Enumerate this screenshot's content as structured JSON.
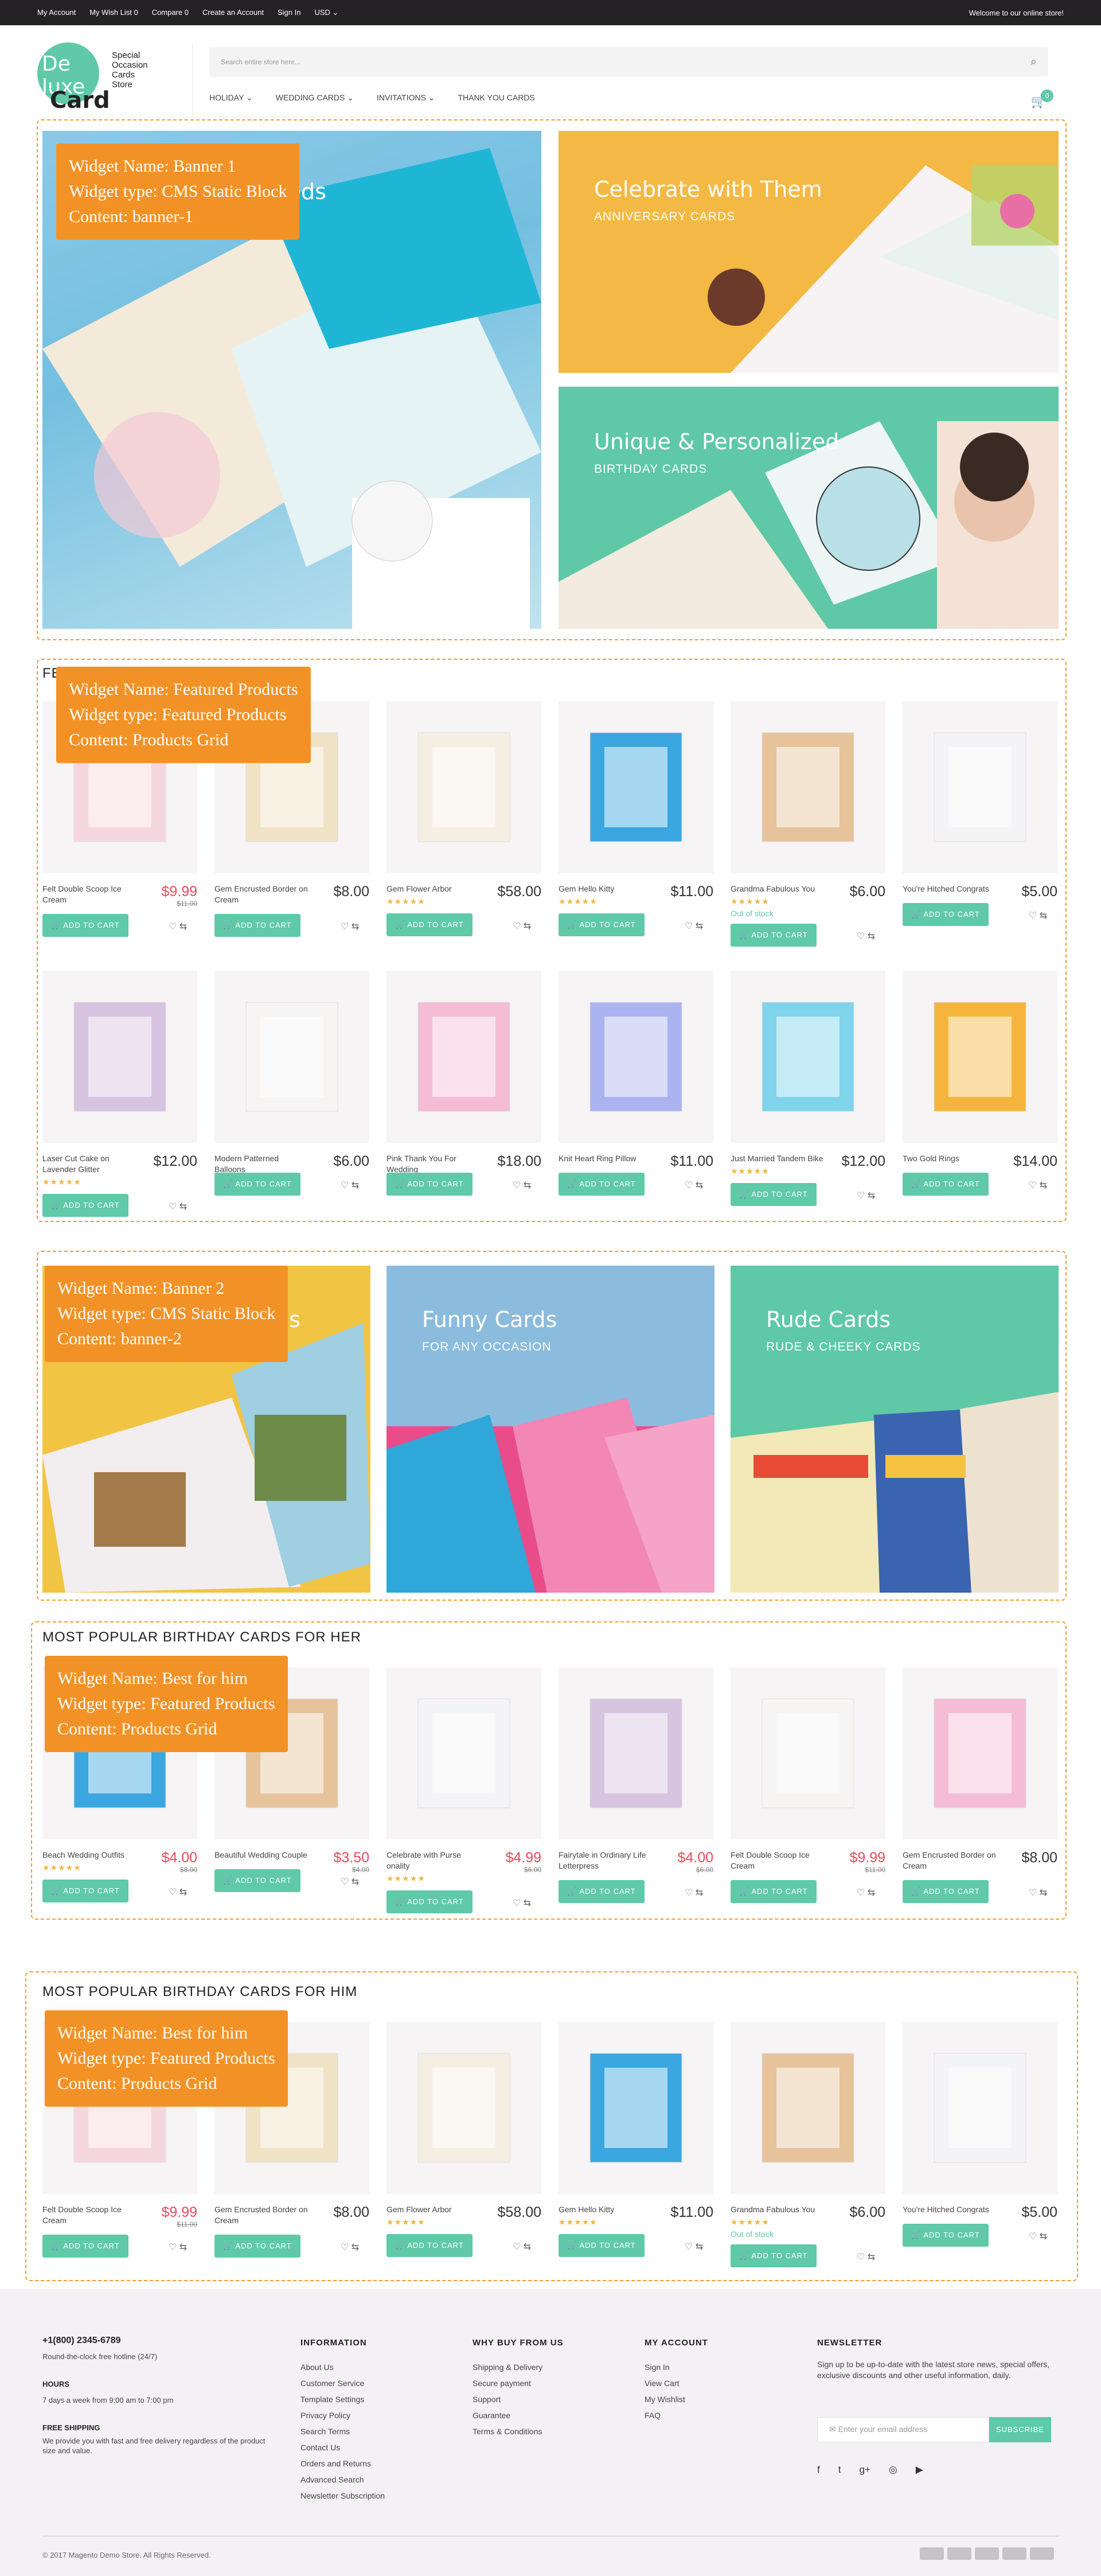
{
  "topbar": {
    "links": [
      "My Account",
      "My Wish List 0",
      "Compare 0",
      "Create an Account",
      "Sign In",
      "USD ⌄"
    ],
    "welcome": "Welcome to our online store!"
  },
  "header": {
    "logo_top": "De luxe",
    "logo_bottom": "Card",
    "tagline": [
      "Special",
      "Occasion",
      "Cards",
      "Store"
    ],
    "search_placeholder": "Search entire store here...",
    "nav": [
      "HOLIDAY ⌄",
      "WEDDING CARDS ⌄",
      "INVITATIONS ⌄",
      "THANK YOU CARDS"
    ],
    "cart_count": "0"
  },
  "widgets": {
    "banner1": [
      "Widget Name: Banner 1",
      "Widget type: CMS Static Block",
      "Content: banner-1"
    ],
    "featured": [
      "Widget Name:  Featured Products",
      "Widget type: Featured Products",
      "Content:  Products Grid"
    ],
    "banner2": [
      "Widget Name: Banner 2",
      "Widget type: CMS Static Block",
      "Content: banner-2"
    ],
    "best_her": [
      "Widget Name: Best for him",
      "Widget type: Featured Products",
      "Content: Products Grid"
    ],
    "best_him": [
      "Widget Name:  Best for him",
      "Widget type: Featured Products",
      "Content: Products Grid"
    ]
  },
  "banner1": {
    "main_title": "ewly-weds",
    "right_top_title": "Celebrate with Them",
    "right_top_sub": "ANNIVERSARY CARDS",
    "right_bottom_title": "Unique & Personalized",
    "right_bottom_sub": "BIRTHDAY CARDS"
  },
  "banner2": {
    "left_title": "ds",
    "mid_title": "Funny Cards",
    "mid_sub": "FOR ANY OCCASION",
    "right_title": "Rude Cards",
    "right_sub": "RUDE & CHEEKY CARDS"
  },
  "sections": {
    "featured_title": "FE",
    "her_title": "MOST POPULAR BIRTHDAY CARDS FOR HER",
    "him_title": "MOST POPULAR BIRTHDAY CARDS FOR HIM"
  },
  "add_to_cart": "ADD TO CART",
  "out_of_stock": "Out of stock",
  "featured_products": [
    {
      "name": "Felt Double Scoop Ice Cream",
      "price": "$9.99",
      "old": "$11.00",
      "sale": true
    },
    {
      "name": "Gem Encrusted Border on Cream",
      "price": "$8.00"
    },
    {
      "name": "Gem Flower Arbor",
      "price": "$58.00",
      "stars": "★★★★★"
    },
    {
      "name": "Gem Hello Kitty",
      "price": "$11.00",
      "stars": "★★★★★"
    },
    {
      "name": "Grandma Fabulous You",
      "price": "$6.00",
      "stars": "★★★★★",
      "oos": true
    },
    {
      "name": "You're Hitched Congrats",
      "price": "$5.00"
    },
    {
      "name": "Laser Cut Cake on Lavender Glitter",
      "price": "$12.00",
      "stars": "★★★★★"
    },
    {
      "name": "Modern Patterned Balloons",
      "price": "$6.00"
    },
    {
      "name": "Pink Thank You For Wedding",
      "price": "$18.00"
    },
    {
      "name": "Knit Heart Ring Pillow",
      "price": "$11.00"
    },
    {
      "name": "Just Married Tandem Bike",
      "price": "$12.00",
      "stars": "★★★★★"
    },
    {
      "name": "Two Gold Rings",
      "price": "$14.00"
    }
  ],
  "her_products": [
    {
      "name": "Beach Wedding Outfits",
      "price": "$4.00",
      "old": "$8.00",
      "sale": true,
      "stars": "★★★★★"
    },
    {
      "name": "Beautiful Wedding Couple",
      "price": "$3.50",
      "old": "$4.00",
      "sale": true
    },
    {
      "name": "Celebrate with Purse onality",
      "price": "$4.99",
      "old": "$6.00",
      "sale": true,
      "stars": "★★★★★"
    },
    {
      "name": "Fairytale in Ordinary Life Letterpress",
      "price": "$4.00",
      "old": "$6.00",
      "sale": true
    },
    {
      "name": "Felt Double Scoop Ice Cream",
      "price": "$9.99",
      "old": "$11.00",
      "sale": true
    },
    {
      "name": "Gem Encrusted Border on Cream",
      "price": "$8.00"
    }
  ],
  "him_products": [
    {
      "name": "Felt Double Scoop Ice Cream",
      "price": "$9.99",
      "old": "$11.00",
      "sale": true
    },
    {
      "name": "Gem Encrusted Border on Cream",
      "price": "$8.00"
    },
    {
      "name": "Gem Flower Arbor",
      "price": "$58.00",
      "stars": "★★★★★"
    },
    {
      "name": "Gem Hello Kitty",
      "price": "$11.00",
      "stars": "★★★★★"
    },
    {
      "name": "Grandma Fabulous You",
      "price": "$6.00",
      "stars": "★★★★★",
      "oos": true
    },
    {
      "name": "You're Hitched Congrats",
      "price": "$5.00"
    }
  ],
  "footer": {
    "phone": "+1(800) 2345-6789",
    "phone_sub": "Round-the-clock free hotline (24/7)",
    "hours_title": "HOURS",
    "hours_text": "7 days a week from 9:00 am to 7:00 pm",
    "shipping_title": "FREE SHIPPING",
    "shipping_text": "We provide you with fast and free delivery regardless of the product size and value.",
    "info_title": "INFORMATION",
    "info_links": [
      "About Us",
      "Customer Service",
      "Template Settings",
      "Privacy Policy",
      "Search Terms",
      "Contact Us",
      "Orders and Returns",
      "Advanced Search",
      "Newsletter Subscription"
    ],
    "why_title": "WHY BUY FROM US",
    "why_links": [
      "Shipping & Delivery",
      "Secure payment",
      "Support",
      "Guarantee",
      "Terms & Conditions"
    ],
    "account_title": "MY ACCOUNT",
    "account_links": [
      "Sign In",
      "View Cart",
      "My Wishlist",
      "FAQ"
    ],
    "newsletter_title": "NEWSLETTER",
    "newsletter_text": "Sign up to be up-to-date with the latest store news, special offers, exclusive discounts and other useful information, daily.",
    "email_placeholder": "Enter your email address",
    "subscribe": "SUBSCRIBE",
    "social": [
      "f",
      "t",
      "g+",
      "◎",
      "▶"
    ],
    "copyright": "© 2017 Magento Demo Store. All Rights Reserved.",
    "payments": [
      "VISA",
      "MC",
      "PAYPAL",
      "AMEX",
      "DISC"
    ]
  },
  "colors": {
    "accent": "#5fc9a8",
    "widget_label": "#f29226",
    "sale": "#e84b5b",
    "topbar": "#242225"
  }
}
